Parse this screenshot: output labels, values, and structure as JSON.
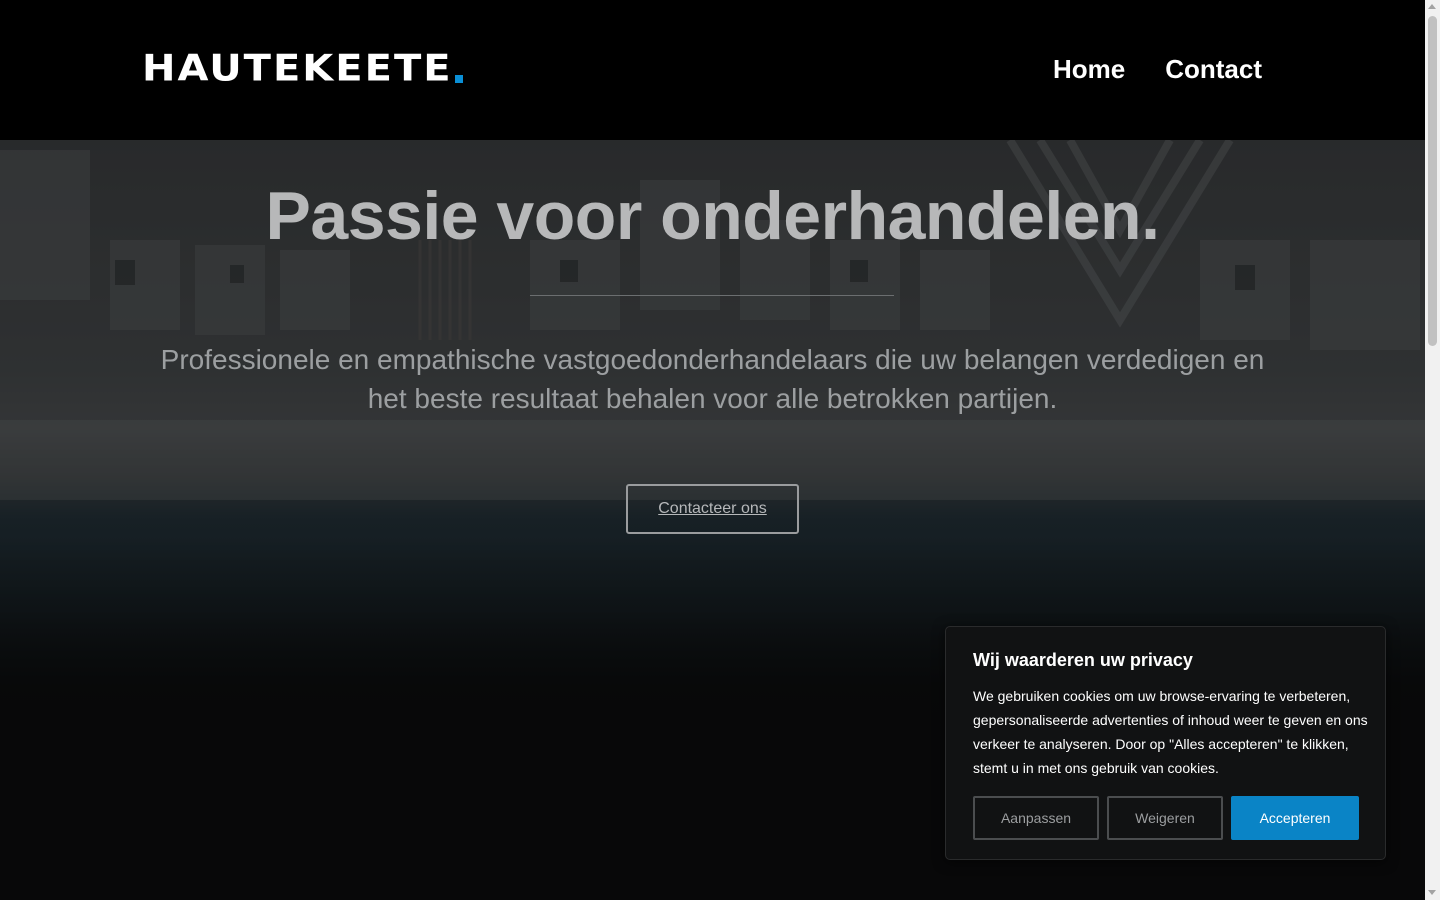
{
  "header": {
    "logo_text": "HAUTEKEETE",
    "logo_accent_color": "#0a8fd6",
    "nav": [
      {
        "label": "Home"
      },
      {
        "label": "Contact"
      }
    ]
  },
  "hero": {
    "title": "Passie voor onderhandelen.",
    "subtitle": "Professionele en empathische vastgoedonderhandelaars die uw belangen verdedigen en het beste resultaat behalen voor alle betrokken partijen.",
    "cta_label": "Contacteer ons"
  },
  "cookie_banner": {
    "title": "Wij waarderen uw privacy",
    "text": "We gebruiken cookies om uw browse-ervaring te verbeteren, gepersonaliseerde advertenties of inhoud weer te geven en ons verkeer te analyseren. Door op \"Alles accepteren\" te klikken, stemt u in met ons gebruik van cookies.",
    "buttons": {
      "customize": "Aanpassen",
      "reject": "Weigeren",
      "accept": "Accepteren"
    },
    "accept_color": "#0a84c6"
  }
}
